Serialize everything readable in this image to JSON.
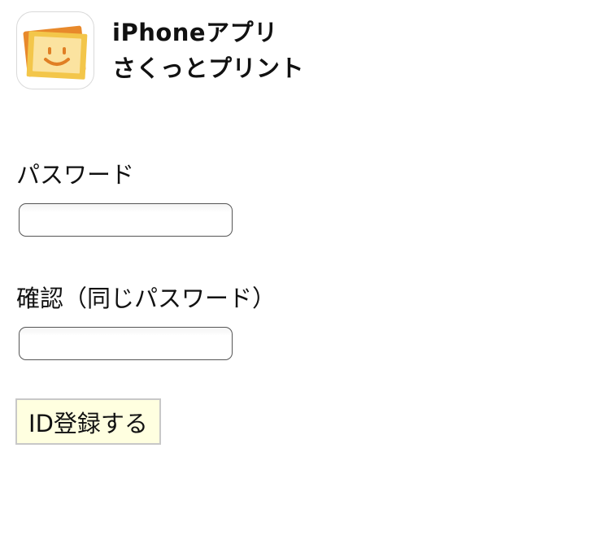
{
  "header": {
    "icon": "smiley-photo-icon",
    "title_line1": "iPhoneアプリ",
    "title_line2": "さくっとプリント"
  },
  "form": {
    "password_label": "パスワード",
    "password_value": "",
    "confirm_label": "確認（同じパスワード）",
    "confirm_value": "",
    "submit_label": "ID登録する"
  },
  "colors": {
    "button_background": "#ffffe0",
    "button_border": "#c8c8c8",
    "input_border": "#555555",
    "icon_orange": "#e8892b",
    "icon_yellow": "#f3c64a"
  }
}
